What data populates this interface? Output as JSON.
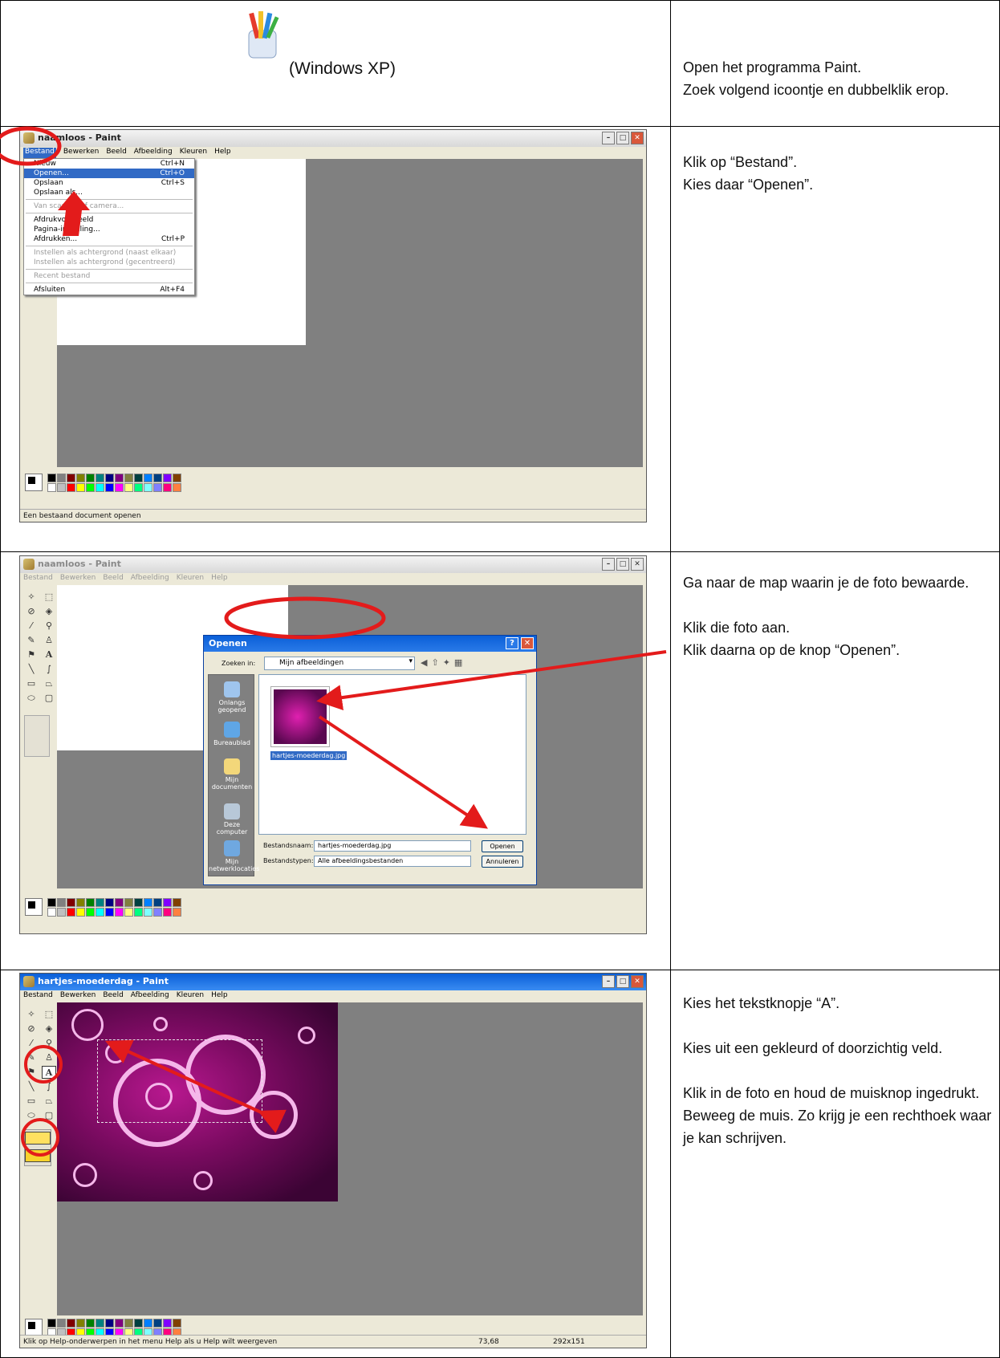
{
  "rows": [
    {
      "caption": "(Windows XP)",
      "lines": [
        "Open het programma Paint.",
        "Zoek volgend icoontje en dubbelklik erop."
      ]
    },
    {
      "lines": [
        "Klik op “Bestand”.",
        "Kies daar “Openen”."
      ],
      "shot": {
        "title": "naamloos - Paint",
        "menubar": [
          "Bestand",
          "Bewerken",
          "Beeld",
          "Afbeelding",
          "Kleuren",
          "Help"
        ],
        "file_menu": [
          {
            "label": "Nieuw",
            "shortcut": "Ctrl+N"
          },
          {
            "label": "Openen...",
            "shortcut": "Ctrl+O",
            "highlight": true
          },
          {
            "label": "Opslaan",
            "shortcut": "Ctrl+S"
          },
          {
            "label": "Opslaan als...",
            "shortcut": ""
          },
          {
            "sep": true
          },
          {
            "label": "Van scanner of camera...",
            "shortcut": "",
            "disabled": true
          },
          {
            "sep": true
          },
          {
            "label": "Afdrukvoorbeeld",
            "shortcut": ""
          },
          {
            "label": "Pagina-instelling...",
            "shortcut": ""
          },
          {
            "label": "Afdrukken...",
            "shortcut": "Ctrl+P"
          },
          {
            "sep": true
          },
          {
            "label": "Instellen als achtergrond (naast elkaar)",
            "shortcut": "",
            "disabled": true
          },
          {
            "label": "Instellen als achtergrond (gecentreerd)",
            "shortcut": "",
            "disabled": true
          },
          {
            "sep": true
          },
          {
            "label": "Recent bestand",
            "shortcut": "",
            "disabled": true
          },
          {
            "sep": true
          },
          {
            "label": "Afsluiten",
            "shortcut": "Alt+F4"
          }
        ],
        "status": "Een bestaand document openen"
      }
    },
    {
      "lines": [
        "Ga naar de map waarin je de foto bewaarde.",
        "",
        "Klik die foto aan.",
        "Klik daarna op de knop “Openen”."
      ],
      "shot": {
        "title": "naamloos - Paint",
        "menubar": [
          "Bestand",
          "Bewerken",
          "Beeld",
          "Afbeelding",
          "Kleuren",
          "Help"
        ],
        "dialog": {
          "title": "Openen",
          "look_in_label": "Zoeken in:",
          "look_in_value": "Mijn afbeeldingen",
          "places": [
            "Onlangs geopend",
            "Bureaublad",
            "Mijn documenten",
            "Deze computer",
            "Mijn netwerklocaties"
          ],
          "file": "hartjes-moederdag.jpg",
          "filename_label": "Bestandsnaam:",
          "filename_value": "hartjes-moederdag.jpg",
          "filetype_label": "Bestandstypen:",
          "filetype_value": "Alle afbeeldingsbestanden",
          "open_button": "Openen",
          "cancel_button": "Annuleren"
        }
      }
    },
    {
      "lines": [
        "Kies het tekstknopje “A”.",
        "",
        "Kies uit een gekleurd of doorzichtig veld.",
        "",
        "Klik in de foto en houd de muisknop ingedrukt.",
        "Beweeg de muis. Zo krijg je een rechthoek waar je kan schrijven."
      ],
      "shot": {
        "title": "hartjes-moederdag - Paint",
        "menubar": [
          "Bestand",
          "Bewerken",
          "Beeld",
          "Afbeelding",
          "Kleuren",
          "Help"
        ],
        "status": "Klik op Help-onderwerpen in het menu Help als u Help wilt weergeven",
        "coords": "73,68",
        "size": "292x151"
      }
    }
  ],
  "colors": {
    "annotation": "#e31b1b",
    "titlebar_active": "#0a5fd8",
    "workspace": "#808080",
    "photo": "#8a0c6e"
  },
  "palette": [
    "#000000",
    "#808080",
    "#800000",
    "#808000",
    "#008000",
    "#008080",
    "#000080",
    "#800080",
    "#808040",
    "#004040",
    "#0080ff",
    "#004080",
    "#8000ff",
    "#804000",
    "#ffffff",
    "#c0c0c0",
    "#ff0000",
    "#ffff00",
    "#00ff00",
    "#00ffff",
    "#0000ff",
    "#ff00ff",
    "#ffff80",
    "#00ff80",
    "#80ffff",
    "#8080ff",
    "#ff0080",
    "#ff8040"
  ]
}
